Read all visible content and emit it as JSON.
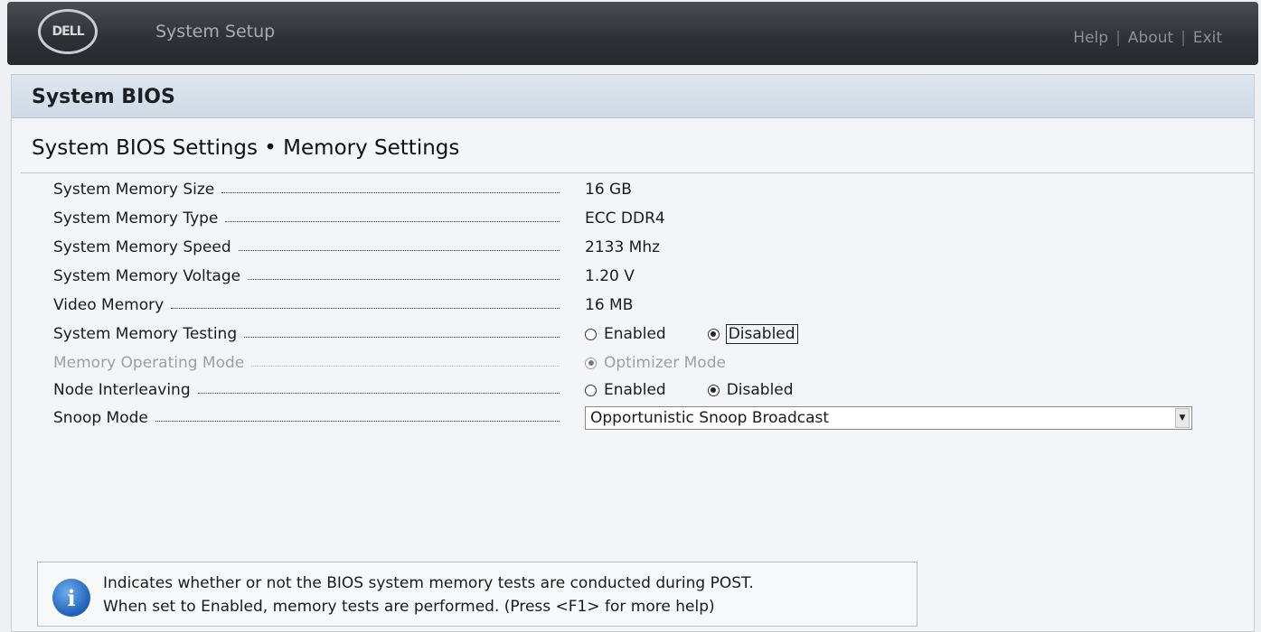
{
  "topbar": {
    "logo": "DELL",
    "app_title": "System Setup",
    "nav": {
      "help": "Help",
      "about": "About",
      "exit": "Exit",
      "separator": "|"
    }
  },
  "section": {
    "title": "System BIOS"
  },
  "page": {
    "title": "System BIOS Settings • Memory Settings"
  },
  "settings": [
    {
      "label": "System Memory Size",
      "value": "16 GB"
    },
    {
      "label": "System Memory Type",
      "value": "ECC DDR4"
    },
    {
      "label": "System Memory Speed",
      "value": "2133 Mhz"
    },
    {
      "label": "System Memory Voltage",
      "value": "1.20 V"
    },
    {
      "label": "Video Memory",
      "value": "16 MB"
    },
    {
      "label": "System Memory Testing",
      "options": [
        "Enabled",
        "Disabled"
      ],
      "selected": "Disabled"
    },
    {
      "label": "Memory Operating Mode",
      "options": [
        "Optimizer Mode"
      ],
      "selected": "Optimizer Mode",
      "disabled": true
    },
    {
      "label": "Node Interleaving",
      "options": [
        "Enabled",
        "Disabled"
      ],
      "selected": "Disabled"
    },
    {
      "label": "Snoop Mode",
      "select_value": "Opportunistic Snoop Broadcast"
    }
  ],
  "help_text": {
    "line1": "Indicates whether or not the BIOS system memory tests are conducted during POST.",
    "line2": "When set to Enabled, memory tests are performed. (Press <F1> for more help)"
  },
  "icons": {
    "info": "info-icon",
    "dropdown": "chevron-down-icon"
  }
}
